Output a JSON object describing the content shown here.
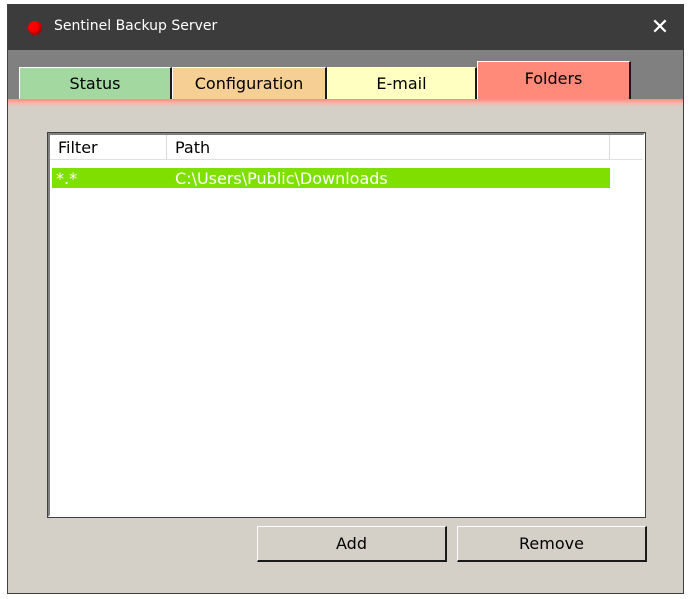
{
  "window": {
    "title": "Sentinel Backup Server",
    "close_glyph": "✕",
    "app_icon": "red-status-dot-icon"
  },
  "tabs": [
    {
      "label": "Status",
      "color": "#a3d9a0"
    },
    {
      "label": "Configuration",
      "color": "#f5cf94"
    },
    {
      "label": "E-mail",
      "color": "#ffffc2"
    },
    {
      "label": "Folders",
      "color": "#ff8a7a",
      "active": true
    }
  ],
  "list": {
    "columns": [
      "Filter",
      "Path"
    ],
    "rows": [
      {
        "filter": "*.*",
        "path": "C:\\Users\\Public\\Downloads",
        "highlight": "#7fe000"
      }
    ]
  },
  "buttons": {
    "add_label": "Add",
    "remove_label": "Remove"
  }
}
